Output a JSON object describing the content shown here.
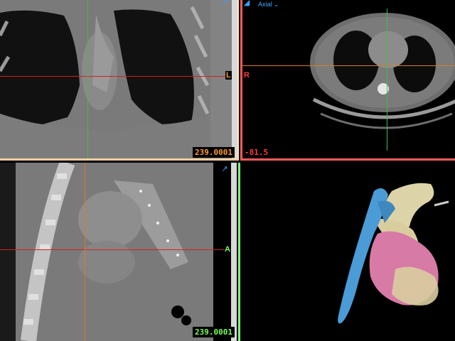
{
  "coronal": {
    "slice_value": "239.0001",
    "orient_right": "L",
    "value_color": "#ff9a2e"
  },
  "axial": {
    "view_label": "Axial",
    "orient_left": "R",
    "slice_value": "-81.5",
    "value_color": "#ff3b3b"
  },
  "sagittal": {
    "slice_value": "239.0001",
    "orient_right": "A",
    "value_color": "#78ff5c"
  },
  "icons": {
    "expand": "expand-arrow-icon"
  },
  "colors": {
    "crosshair_h": "#d42020",
    "crosshair_v": "#3fbf3f",
    "crosshair_orange": "#e07a20",
    "aorta": "#4a9bd6",
    "heart": "#d77aa6",
    "bone": "#ddd3a8"
  }
}
